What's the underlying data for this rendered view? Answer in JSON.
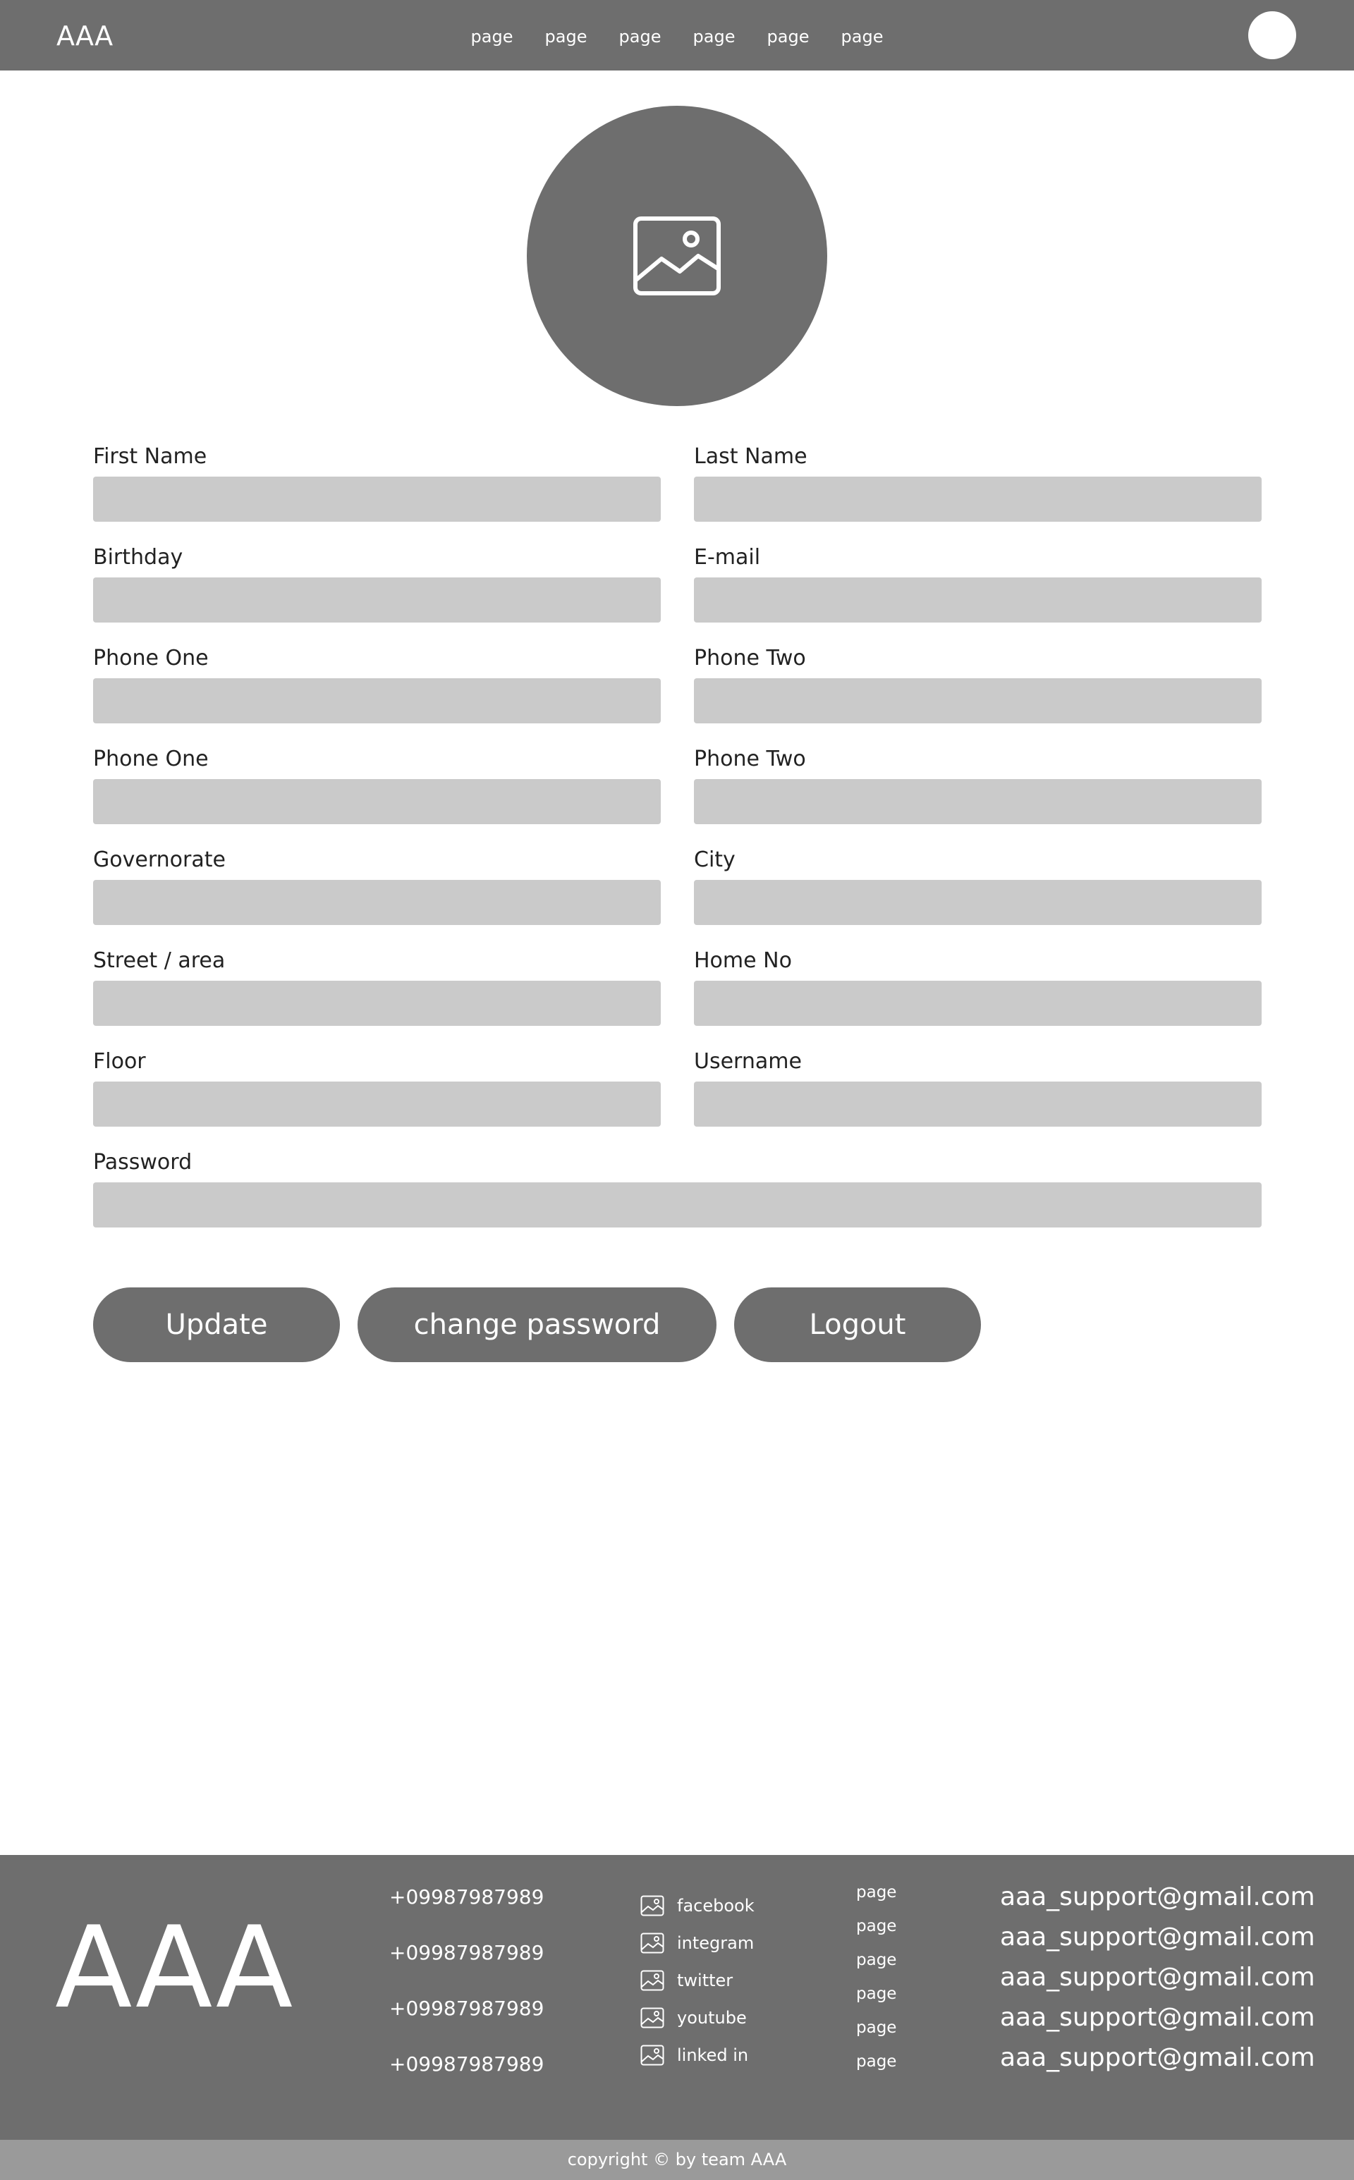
{
  "header": {
    "logo": "AAA",
    "nav": [
      "page",
      "page",
      "page",
      "page",
      "page",
      "page"
    ],
    "avatar_icon": "user-avatar"
  },
  "profile": {
    "image_icon": "image-placeholder-icon"
  },
  "form": {
    "first_name": "First Name",
    "last_name": "Last Name",
    "birthday": "Birthday",
    "email": "E-mail",
    "phone_one_1": "Phone One",
    "phone_two_1": "Phone Two",
    "phone_one_2": "Phone One",
    "phone_two_2": "Phone Two",
    "governorate": "Governorate",
    "city": "City",
    "street": "Street / area",
    "home_no": "Home No",
    "floor": "Floor",
    "username": "Username",
    "password": "Password"
  },
  "buttons": {
    "update": "Update",
    "change_password": "change password",
    "logout": "Logout"
  },
  "footer": {
    "logo": "AAA",
    "phones": [
      "+09987987989",
      "+09987987989",
      "+09987987989",
      "+09987987989"
    ],
    "social": [
      {
        "label": "facebook",
        "icon": "image-icon"
      },
      {
        "label": "integram",
        "icon": "image-icon"
      },
      {
        "label": "twitter",
        "icon": "image-icon"
      },
      {
        "label": "youtube",
        "icon": "image-icon"
      },
      {
        "label": "linked in",
        "icon": "image-icon"
      }
    ],
    "pages": [
      "page",
      "page",
      "page",
      "page",
      "page",
      "page"
    ],
    "emails": [
      "aaa_support@gmail.com",
      "aaa_support@gmail.com",
      "aaa_support@gmail.com",
      "aaa_support@gmail.com",
      "aaa_support@gmail.com"
    ],
    "copyright": "copyright © by team AAA"
  },
  "colors": {
    "primary_gray": "#6e6e6e",
    "input_gray": "#cacaca",
    "copyright_bar": "#9a9a9a"
  }
}
